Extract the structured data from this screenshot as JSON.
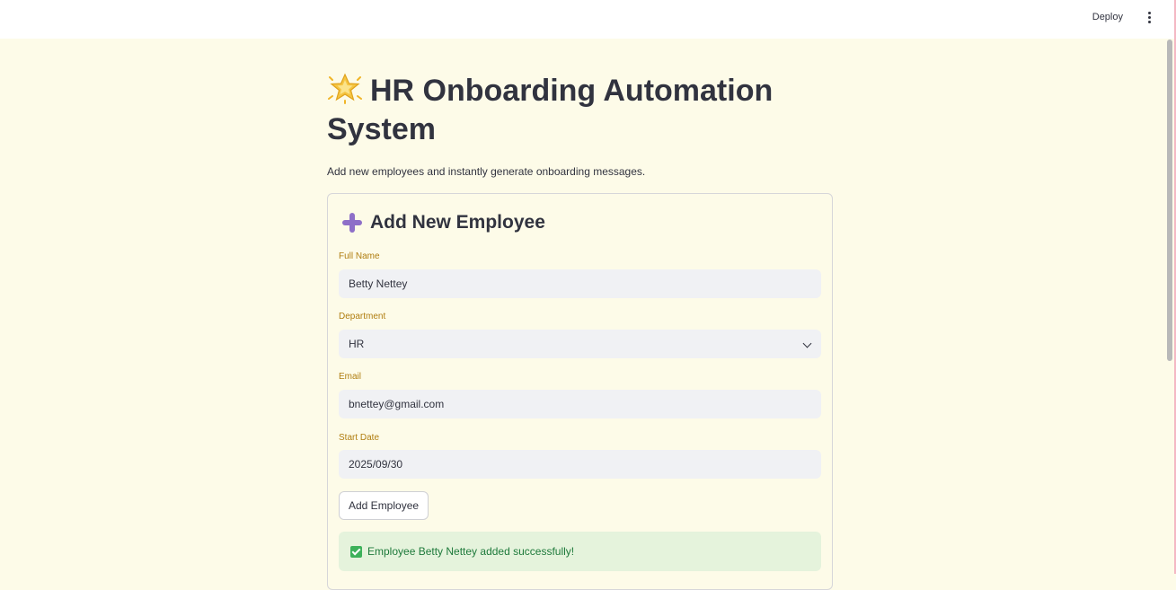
{
  "topbar": {
    "deploy_label": "Deploy",
    "menu_icon": "vertical-dots-icon"
  },
  "page": {
    "title_icon": "glowing-star-icon",
    "title": "HR Onboarding Automation System",
    "subtitle": "Add new employees and instantly generate onboarding messages."
  },
  "form": {
    "title_icon": "plus-icon",
    "title": "Add New Employee",
    "fields": {
      "full_name": {
        "label": "Full Name",
        "value": "Betty Nettey"
      },
      "department": {
        "label": "Department",
        "value": "HR"
      },
      "email": {
        "label": "Email",
        "value": "bnettey@gmail.com"
      },
      "start_date": {
        "label": "Start Date",
        "value": "2025/09/30"
      }
    },
    "submit_label": "Add Employee",
    "success_message": "Employee Betty Nettey added successfully!"
  },
  "colors": {
    "background": "#fdfbe8",
    "label": "#b07d0f",
    "input_bg": "#f0f1f4",
    "success_bg": "#e5f3dc",
    "success_text": "#1e7a3b",
    "plus_icon": "#8e6fc8"
  }
}
